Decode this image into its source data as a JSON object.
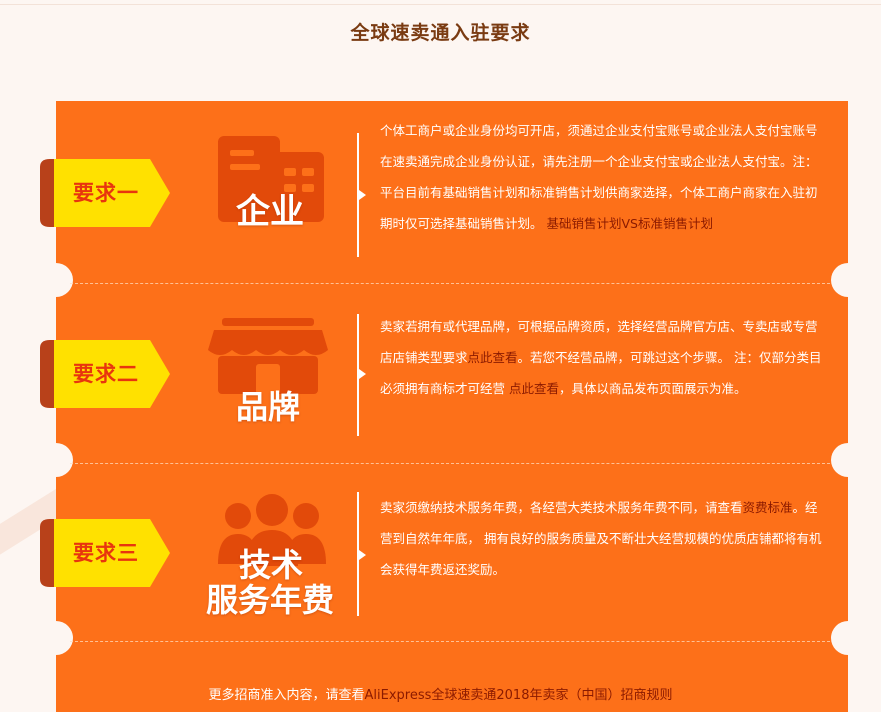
{
  "page": {
    "title": "全球速卖通入驻要求"
  },
  "requirements": [
    {
      "tag": "要求一",
      "icon_name": "building-icon",
      "label": "企业",
      "desc_main": "个体工商户或企业身份均可开店，须通过企业支付宝账号或企业法人支付宝账号在速卖通完成企业身份认证，请先注册一个企业支付宝或企业法人支付宝。注：平台目前有基础销售计划和标准销售计划供商家选择，个体工商户商家在入驻初期时仅可选择基础销售计划。",
      "desc_link": "基础销售计划VS标准销售计划"
    },
    {
      "tag": "要求二",
      "icon_name": "storefront-icon",
      "label": "品牌",
      "desc_a": "卖家若拥有或代理品牌，可根据品牌资质，选择经营品牌官方店、专卖店或专营店店铺类型要求",
      "link_a": "点此查看",
      "desc_b": "。若您不经营品牌，可跳过这个步骤。 注：仅部分类目必须拥有商标才可经营 ",
      "link_b": "点此查看",
      "desc_c": "，具体以商品发布页面展示为准。"
    },
    {
      "tag": "要求三",
      "icon_name": "people-group-icon",
      "label_line1": "技术",
      "label_line2": "服务年费",
      "desc_a": "卖家须缴纳技术服务年费，各经营大类技术服务年费不同，请查看",
      "link_a": "资费标准",
      "desc_b": "。经营到自然年年底， 拥有良好的服务质量及不断壮大经营规模的优质店铺都将有机会获得年费返还奖励。"
    }
  ],
  "footer": {
    "prefix": "更多招商准入内容，请查看",
    "link": "AliExpress全球速卖通2018年卖家（中国）招商规则"
  },
  "colors": {
    "panel": "#fd7019",
    "tag_yellow": "#ffe100",
    "link": "#8b1a00",
    "icon_dark": "#e24a0a"
  }
}
